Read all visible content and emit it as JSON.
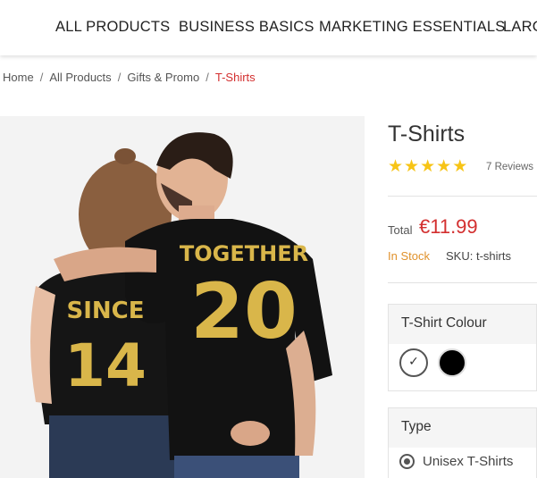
{
  "nav": {
    "items": [
      "ALL PRODUCTS",
      "BUSINESS BASICS",
      "MARKETING ESSENTIALS",
      "LARG"
    ]
  },
  "breadcrumb": {
    "home": "Home",
    "all_products": "All Products",
    "category": "Gifts & Promo",
    "current": "T-Shirts",
    "separator": "/"
  },
  "product": {
    "title": "T-Shirts",
    "rating": 5,
    "reviews": "7 Reviews",
    "total_label": "Total",
    "price": "€11.99",
    "stock": "In Stock",
    "sku": "SKU: t-shirts",
    "image": {
      "shirt_left_line1": "SINCE",
      "shirt_left_line2": "14",
      "shirt_right_line1": "TOGETHER",
      "shirt_right_line2": "20"
    }
  },
  "colour_option": {
    "heading": "T-Shirt Colour",
    "swatches": [
      {
        "name": "white",
        "color": "#ffffff",
        "selected": true
      },
      {
        "name": "black",
        "color": "#000000",
        "selected": false
      }
    ],
    "check_glyph": "✓"
  },
  "type_option": {
    "heading": "Type",
    "selected": "Unisex T-Shirts"
  },
  "colors": {
    "accent_red": "#d32f2f",
    "star_yellow": "#f7c416",
    "stock_orange": "#e0922c",
    "print_gold": "#d9b64a"
  }
}
